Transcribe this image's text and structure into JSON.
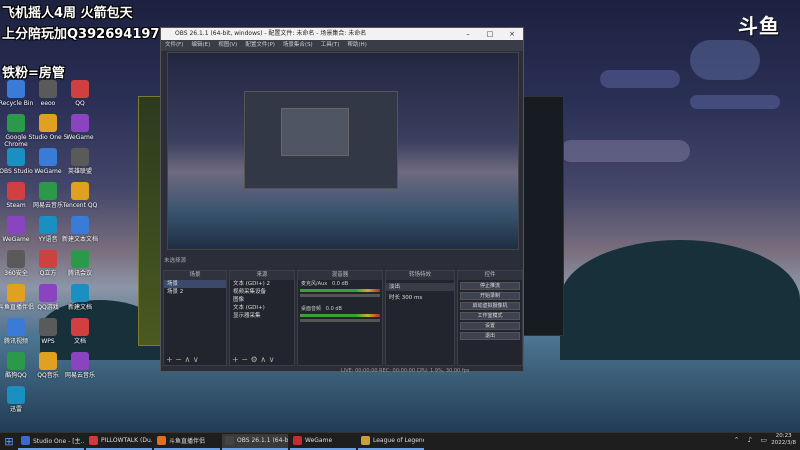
{
  "stream_overlay": {
    "line1": "飞机摇人4周  火箭包天",
    "line2": "上分陪玩加Q392694197",
    "line3": "铁粉=房管"
  },
  "watermark": "斗鱼",
  "obs": {
    "title": "OBS 26.1.1 (64-bit, windows) - 配置文件: 未命名 - 场景集合: 未命名",
    "menu": [
      "文件(F)",
      "编辑(E)",
      "视图(V)",
      "配置文件(P)",
      "场景集合(S)",
      "工具(T)",
      "帮助(H)"
    ],
    "scene_label": "未选择源",
    "panels": {
      "scenes": {
        "header": "场景",
        "items": [
          "场景",
          "场景 2"
        ]
      },
      "sources": {
        "header": "来源",
        "items": [
          "文本 (GDI+) 2",
          "视频采集设备",
          "图像",
          "文本 (GDI+)",
          "显示器采集"
        ]
      },
      "mixer": {
        "header": "混音器",
        "tracks": [
          "麦克风/Aux",
          "桌面音频"
        ],
        "levels": [
          "0.0 dB",
          "0.0 dB"
        ]
      },
      "transitions": {
        "header": "转场特效",
        "type": "淡出",
        "duration_label": "时长",
        "duration": "300 ms"
      },
      "controls": {
        "header": "控件",
        "buttons": [
          "停止推流",
          "开始录制",
          "启动虚拟摄像机",
          "工作室模式",
          "设置",
          "退出"
        ]
      }
    },
    "status": "LIVE: 00:00:00   REC: 00:00:00   CPU: 1.9%, 30.00 fps"
  },
  "desktop_icons": [
    {
      "label": "Recycle Bin"
    },
    {
      "label": "eeoo"
    },
    {
      "label": "QQ"
    },
    {
      "label": "Google Chrome"
    },
    {
      "label": "Studio One 5"
    },
    {
      "label": "WeGame"
    },
    {
      "label": "OBS Studio"
    },
    {
      "label": "WeGame"
    },
    {
      "label": "英雄联盟"
    },
    {
      "label": "Steam"
    },
    {
      "label": "网易云音乐"
    },
    {
      "label": "Tencent QQ"
    },
    {
      "label": "WeGame"
    },
    {
      "label": "YY语音"
    },
    {
      "label": "新建文本文档"
    },
    {
      "label": "360安全"
    },
    {
      "label": "Q立方"
    },
    {
      "label": "腾讯会议"
    },
    {
      "label": "斗鱼直播伴侣"
    },
    {
      "label": "QQ游戏"
    },
    {
      "label": "新建文档"
    },
    {
      "label": "腾讯视频"
    },
    {
      "label": "WPS"
    },
    {
      "label": "文档"
    },
    {
      "label": "酷狗QQ"
    },
    {
      "label": "QQ音乐"
    },
    {
      "label": "网易云音乐"
    },
    {
      "label": "迅雷"
    }
  ],
  "taskbar": {
    "items": [
      {
        "label": "Studio One - [主...",
        "color": "#3a6ad0"
      },
      {
        "label": "PILLOWTALK (Du...",
        "color": "#d03a3a"
      },
      {
        "label": "斗鱼直播伴侣",
        "color": "#e07020"
      },
      {
        "label": "OBS 26.1.1 (64-bit...",
        "color": "#444"
      },
      {
        "label": "WeGame",
        "color": "#c03030"
      },
      {
        "label": "League of Legends",
        "color": "#c8a040"
      }
    ],
    "time": "20:23",
    "date": "2022/3/8"
  }
}
